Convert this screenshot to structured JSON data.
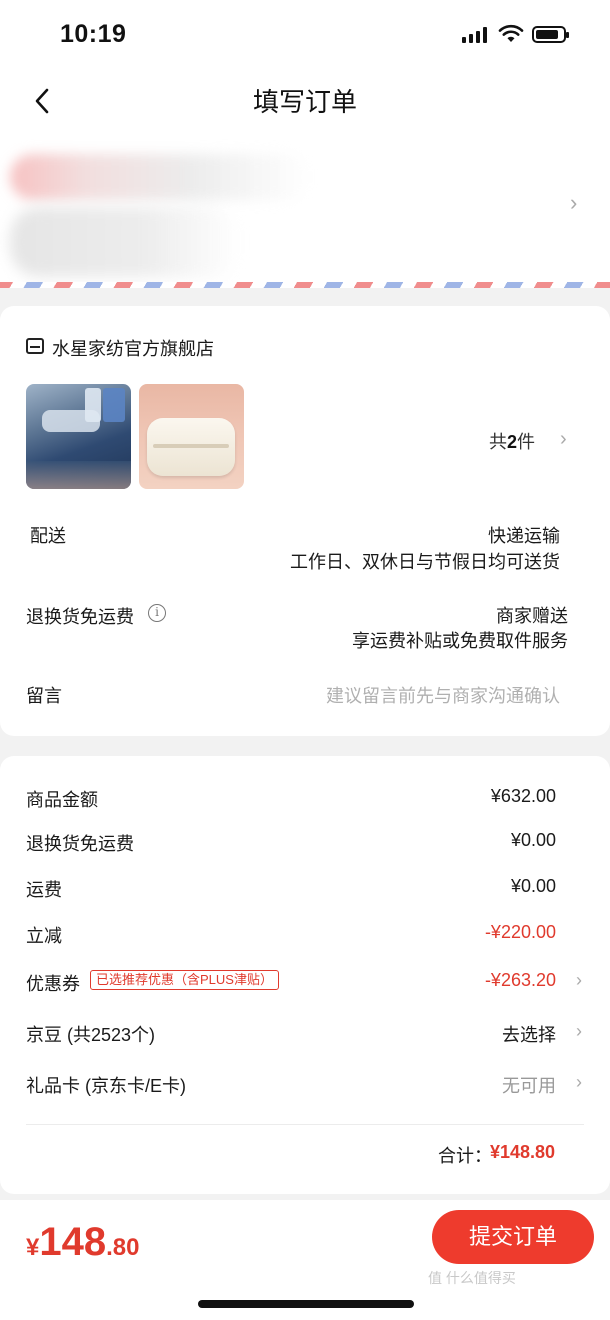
{
  "status_bar": {
    "time": "10:19"
  },
  "nav": {
    "title": "填写订单",
    "back_icon": "chevron-left-icon"
  },
  "address": {
    "arrow": "›"
  },
  "shop": {
    "name": "水星家纺官方旗舰店",
    "item_count_prefix": "共",
    "item_count": "2",
    "item_count_suffix": "件",
    "arrow": "›"
  },
  "delivery": {
    "label": "配送",
    "method": "快递运输",
    "time": "工作日、双休日与节假日均可送货"
  },
  "return_shipping": {
    "label": "退换货免运费",
    "info_icon": "i",
    "value": "商家赠送",
    "note": "享运费补贴或免费取件服务"
  },
  "message": {
    "label": "留言",
    "placeholder": "建议留言前先与商家沟通确认"
  },
  "price_rows": {
    "goods": {
      "label": "商品金额",
      "value": "¥632.00"
    },
    "return_fee": {
      "label": "退换货免运费",
      "value": "¥0.00"
    },
    "shipping": {
      "label": "运费",
      "value": "¥0.00"
    },
    "discount": {
      "label": "立减",
      "value": "-¥220.00"
    },
    "coupon": {
      "label": "优惠券",
      "tag": "已选推荐优惠（含PLUS津贴）",
      "value": "-¥263.20"
    },
    "jingdou": {
      "label": "京豆 (共2523个)",
      "value": "去选择"
    },
    "gift_card": {
      "label": "礼品卡 (京东卡/E卡)",
      "value": "无可用"
    }
  },
  "total": {
    "label": "合计：",
    "value": "¥148.80"
  },
  "bottom_bar": {
    "currency": "¥",
    "price_int": "148",
    "price_dec": ".80",
    "submit_label": "提交订单"
  },
  "watermark": "值 什么值得买",
  "colors": {
    "accent": "#e03a2d",
    "submit_bg": "#ee3b2d"
  }
}
